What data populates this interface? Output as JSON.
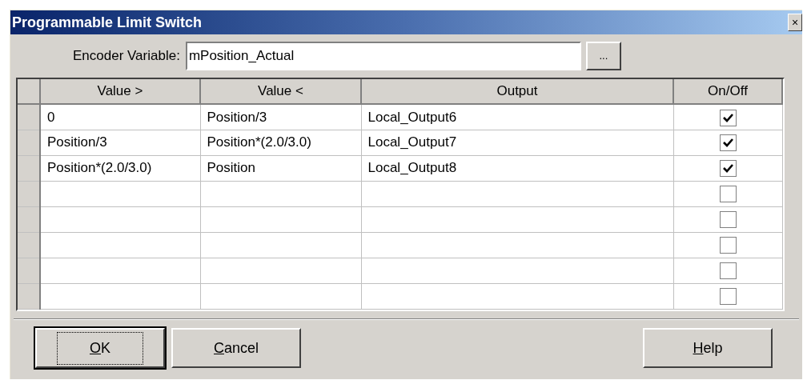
{
  "window": {
    "title": "Programmable Limit Switch",
    "close": "×"
  },
  "encoder": {
    "label": "Encoder Variable:",
    "value": "mPosition_Actual",
    "browse": "..."
  },
  "table": {
    "columns": [
      "Value >",
      "Value <",
      "Output",
      "On/Off"
    ],
    "rows": [
      {
        "cells": [
          "0",
          "Position/3",
          "Local_Output6"
        ],
        "on": true
      },
      {
        "cells": [
          "Position/3",
          "Position*(2.0/3.0)",
          "Local_Output7"
        ],
        "on": true
      },
      {
        "cells": [
          "Position*(2.0/3.0)",
          "Position",
          "Local_Output8"
        ],
        "on": true
      },
      {
        "on": false
      },
      {
        "on": false
      },
      {
        "on": false
      },
      {
        "on": false
      },
      {
        "on": false
      }
    ]
  },
  "buttons": [
    {
      "label": "OK",
      "mnemonic": true,
      "focused": true,
      "pushed_right": false
    },
    {
      "label": "Cancel",
      "mnemonic": true,
      "focused": false,
      "pushed_right": false
    },
    {
      "label": "Help",
      "mnemonic": true,
      "focused": false,
      "pushed_right": true
    }
  ]
}
